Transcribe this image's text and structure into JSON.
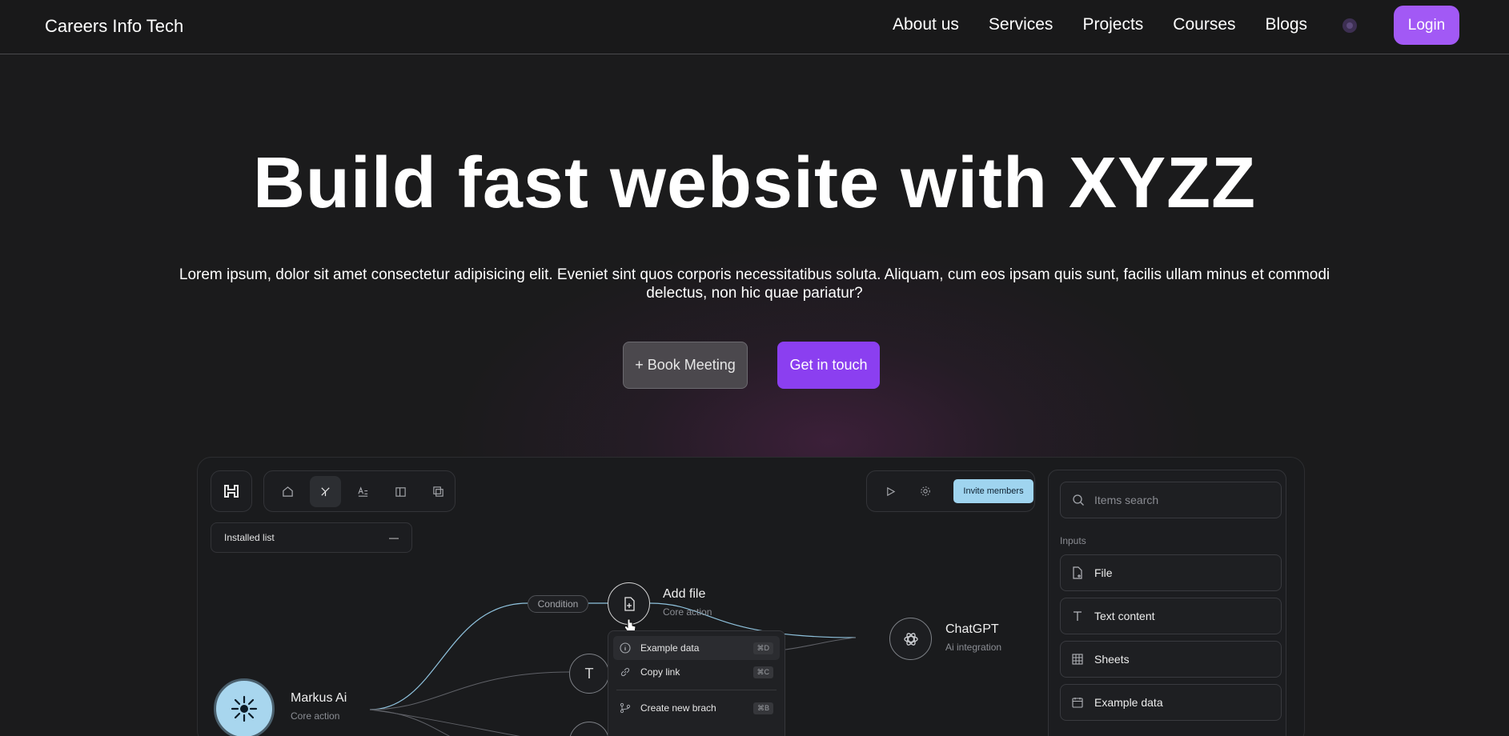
{
  "nav": {
    "brand": "Careers Info Tech",
    "links": [
      "About us",
      "Services",
      "Projects",
      "Courses",
      "Blogs"
    ],
    "login": "Login"
  },
  "hero": {
    "title": "Build fast website with XYZZ",
    "subtitle": "Lorem ipsum, dolor sit amet consectetur adipisicing elit. Eveniet sint quos corporis necessitatibus soluta. Aliquam, cum eos ipsam quis sunt, facilis ullam minus et commodi delectus, non hic quae pariatur?",
    "book_button": "+ Book Meeting",
    "touch_button": "Get in touch"
  },
  "app": {
    "invite_button": "Invite members",
    "installed_list": "Installed list",
    "installed_toggle": "—",
    "condition_label": "Condition",
    "nodes": {
      "add_file": {
        "title": "Add file",
        "subtitle": "Core action"
      },
      "chatgpt": {
        "title": "ChatGPT",
        "subtitle": "Ai integration"
      },
      "markus": {
        "title": "Markus Ai",
        "subtitle": "Core action"
      },
      "text_glyph": "T"
    },
    "menu": [
      {
        "label": "Example data",
        "shortcut": "⌘D",
        "icon": "info-icon"
      },
      {
        "label": "Copy link",
        "shortcut": "⌘C",
        "icon": "link-icon"
      },
      {
        "label": "Create new brach",
        "shortcut": "⌘B",
        "icon": "branch-icon"
      }
    ],
    "sidebar": {
      "search_placeholder": "Items search",
      "inputs_label": "Inputs",
      "items": [
        {
          "label": "File",
          "icon": "file-plus-icon"
        },
        {
          "label": "Text content",
          "icon": "text-icon"
        },
        {
          "label": "Sheets",
          "icon": "table-icon"
        },
        {
          "label": "Example data",
          "icon": "calendar-icon"
        }
      ]
    }
  },
  "colors": {
    "accent_purple": "#a259f5",
    "touch_purple": "#8b3ff0",
    "invite_blue": "#9fd4ef",
    "background": "#1b1b1c"
  }
}
